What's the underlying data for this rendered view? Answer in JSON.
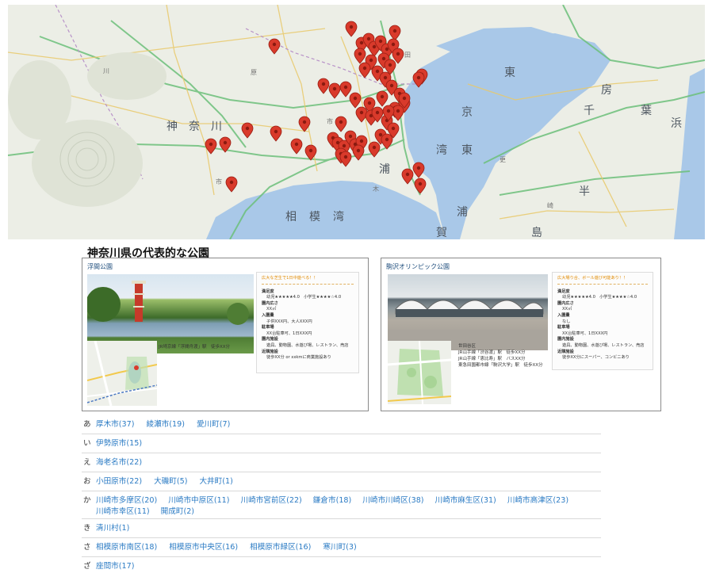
{
  "map": {
    "labels": {
      "kanagawa": [
        "神",
        "奈",
        "川"
      ],
      "tokyo_chars": [
        "東",
        "京"
      ],
      "sagami_bay": [
        "相",
        "模",
        "湾"
      ],
      "chiba_chars": [
        "千",
        "葉"
      ],
      "other": [
        "東",
        "湾",
        "浦",
        "賀",
        "浦",
        "半",
        "島",
        "房",
        "浜",
        "木",
        "更",
        "津",
        "市",
        "市",
        "川",
        "原",
        "田",
        "崎",
        "町"
      ]
    }
  },
  "heading": "神奈川県の代表的な公園",
  "cards": [
    {
      "title": "浮間公園",
      "access": [
        "JR埼京線「浮間舟渡」駅　徒歩XX分"
      ],
      "catch": "広大な芝生で1日中遊べる！！",
      "info": [
        {
          "k": "満足度",
          "v": "幼児★★★★★4.0　小学生★★★★☆4.0"
        },
        {
          "k": "園内広さ",
          "v": "XX㎡"
        },
        {
          "k": "入園量",
          "v": "子供XXX円、大人XXX円"
        },
        {
          "k": "駐車場",
          "v": "XX台駐車可、1日XXX円"
        },
        {
          "k": "園内施設",
          "v": "遊具、動物園、水遊び場、レストラン、売店"
        },
        {
          "k": "近隣施設",
          "v": "徒歩XX分 or xxkmに商業施設あり"
        }
      ]
    },
    {
      "title": "駒沢オリンピック公園",
      "access": [
        "世田谷区",
        "JR山手線「渋谷渡」駅　徒歩XX分",
        "JR山手線「恵比寿」駅　バスXX分",
        "東急田園都市線「駒沢大学」駅　徒歩XX分"
      ],
      "catch": "広大場り合、ボール遊び可能あり！！",
      "info": [
        {
          "k": "満足度",
          "v": "幼児★★★★★4.0　小学生★★★★☆4.0"
        },
        {
          "k": "園内広さ",
          "v": "XX㎡"
        },
        {
          "k": "入園量",
          "v": "なし"
        },
        {
          "k": "駐車場",
          "v": "XX台駐車可、1日XXX円"
        },
        {
          "k": "園内施設",
          "v": "遊具、動物園、水遊び場、レストラン、売店"
        },
        {
          "k": "近隣施設",
          "v": "徒歩XX分にスーパー、コンビニあり"
        }
      ]
    }
  ],
  "index": [
    {
      "kana": "あ",
      "links": [
        "厚木市(37)",
        "綾瀬市(19)",
        "愛川町(7)"
      ]
    },
    {
      "kana": "い",
      "links": [
        "伊勢原市(15)"
      ]
    },
    {
      "kana": "え",
      "links": [
        "海老名市(22)"
      ]
    },
    {
      "kana": "お",
      "links": [
        "小田原市(22)",
        "大磯町(5)",
        "大井町(1)"
      ]
    },
    {
      "kana": "か",
      "links": [
        "川崎市多摩区(20)",
        "川崎市中原区(11)",
        "川崎市宮前区(22)",
        "鎌倉市(18)",
        "川崎市川崎区(38)",
        "川崎市麻生区(31)",
        "川崎市高津区(23)",
        "川崎市幸区(11)",
        "開成町(2)"
      ]
    },
    {
      "kana": "き",
      "links": [
        "清川村(1)"
      ]
    },
    {
      "kana": "さ",
      "links": [
        "相模原市南区(18)",
        "相模原市中央区(16)",
        "相模原市緑区(16)",
        "寒川町(3)"
      ]
    },
    {
      "kana": "ざ",
      "links": [
        "座間市(17)"
      ]
    }
  ]
}
